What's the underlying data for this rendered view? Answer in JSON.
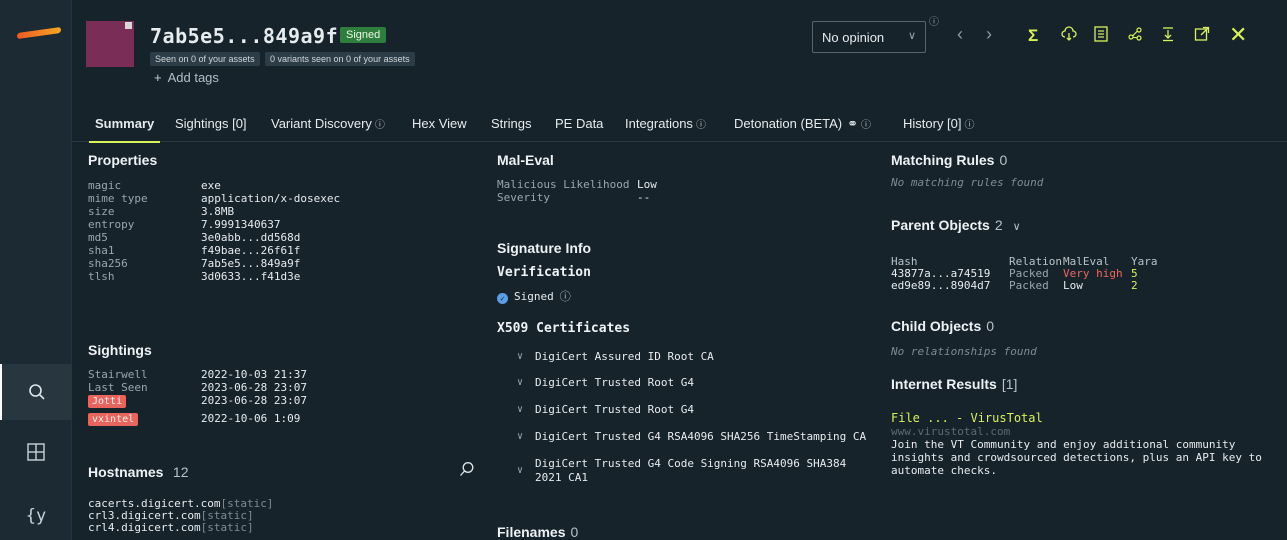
{
  "app": {
    "title": "7ab5e5...849a9f"
  },
  "header": {
    "hash": "7ab5e5...849a9f",
    "signed_badge": "Signed",
    "seen_assets": "Seen on 0 of your assets",
    "variants_seen": "0 variants seen on 0 of your assets",
    "add_tags": "Add tags",
    "opinion": "No opinion"
  },
  "tabs": [
    {
      "label": "Summary",
      "active": true
    },
    {
      "label": "Sightings [0]"
    },
    {
      "label": "Variant Discovery"
    },
    {
      "label": "Hex View"
    },
    {
      "label": "Strings"
    },
    {
      "label": "PE Data"
    },
    {
      "label": "Integrations"
    },
    {
      "label": "Detonation (BETA)"
    },
    {
      "label": "History [0]"
    }
  ],
  "properties": {
    "title": "Properties",
    "rows": [
      {
        "k": "magic",
        "v": "exe"
      },
      {
        "k": "mime type",
        "v": "application/x-dosexec"
      },
      {
        "k": "size",
        "v": "3.8MB"
      },
      {
        "k": "entropy",
        "v": "7.9991340637"
      },
      {
        "k": "md5",
        "v": "3e0abb...dd568d"
      },
      {
        "k": "sha1",
        "v": "f49bae...26f61f"
      },
      {
        "k": "sha256",
        "v": "7ab5e5...849a9f"
      },
      {
        "k": "tlsh",
        "v": "3d0633...f41d3e"
      }
    ]
  },
  "sightings": {
    "title": "Sightings",
    "rows": [
      {
        "k": "Stairwell",
        "v": "2022-10-03 21:37"
      },
      {
        "k": "Last Seen",
        "v": "2023-06-28 23:07"
      },
      {
        "k": "Jotti",
        "v": "2023-06-28 23:07"
      },
      {
        "k": "vxintel",
        "v": "2022-10-06 1:09"
      }
    ]
  },
  "hostnames": {
    "title": "Hostnames",
    "count": "12",
    "static": "[static]",
    "items": [
      "cacerts.digicert.com",
      "crl3.digicert.com",
      "crl4.digicert.com"
    ]
  },
  "maleval": {
    "title": "Mal-Eval",
    "likelihood_label": "Malicious Likelihood",
    "likelihood": "Low",
    "severity_label": "Severity",
    "severity": "--"
  },
  "signature": {
    "title": "Signature Info",
    "verification_title": "Verification",
    "verification": "Signed",
    "x509_title": "X509 Certificates",
    "certs": [
      "DigiCert Assured ID Root CA",
      "DigiCert Trusted Root G4",
      "DigiCert Trusted Root G4",
      "DigiCert Trusted G4 RSA4096 SHA256 TimeStamping CA",
      "DigiCert Trusted G4 Code Signing RSA4096 SHA384",
      "2021 CA1"
    ]
  },
  "filenames": {
    "title": "Filenames",
    "count": "0"
  },
  "matching": {
    "title": "Matching Rules",
    "count": "0",
    "empty": "No matching rules found"
  },
  "parents": {
    "title": "Parent Objects",
    "count": "2",
    "headers": [
      "Hash",
      "Relation",
      "MalEval",
      "Yara"
    ],
    "rows": [
      [
        "43877a...a74519",
        "Packed",
        "Very high",
        "5"
      ],
      [
        "ed9e89...8904d7",
        "Packed",
        "Low",
        "2"
      ]
    ]
  },
  "children": {
    "title": "Child Objects",
    "count": "0",
    "empty": "No relationships found"
  },
  "internet": {
    "title": "Internet Results",
    "count": "[1]",
    "result_title": "File ... - VirusTotal",
    "result_url": "www.virustotal.com",
    "desc1": "Join the VT Community and enjoy additional community",
    "desc2": "insights and crowdsourced detections, plus an API key to",
    "desc3": "automate checks."
  },
  "colors": {
    "accent": "#d7f25a",
    "signed": "#2f7d3c",
    "danger": "#e8645d",
    "bg": "#17232b"
  }
}
